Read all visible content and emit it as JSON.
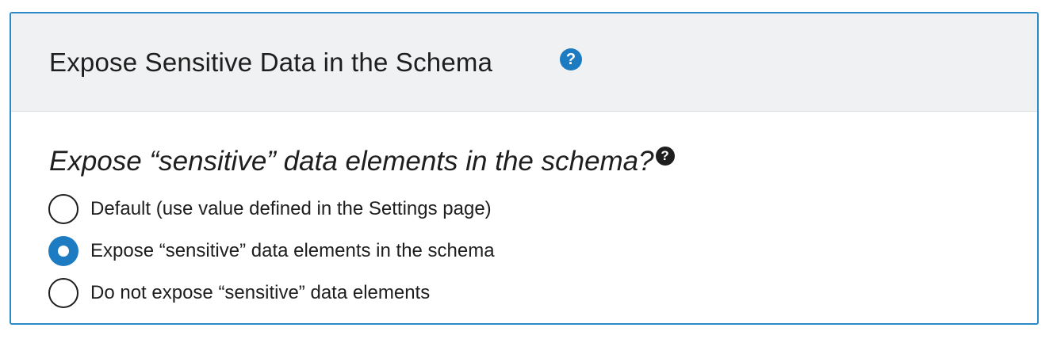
{
  "panel": {
    "title": "Expose Sensitive Data in the Schema",
    "help_icon": "question-circle-icon"
  },
  "field": {
    "question": "Expose “sensitive” data elements in the schema?",
    "help_icon": "question-circle-icon",
    "options": [
      {
        "label": "Default (use value defined in the Settings page)",
        "checked": false
      },
      {
        "label": "Expose “sensitive” data elements in the schema",
        "checked": true
      },
      {
        "label": "Do not expose “sensitive” data elements",
        "checked": false
      }
    ]
  },
  "colors": {
    "accent": "#1d7cc1",
    "border": "#2b8ac6",
    "header_bg": "#f0f1f2",
    "text": "#1e1e1e"
  }
}
